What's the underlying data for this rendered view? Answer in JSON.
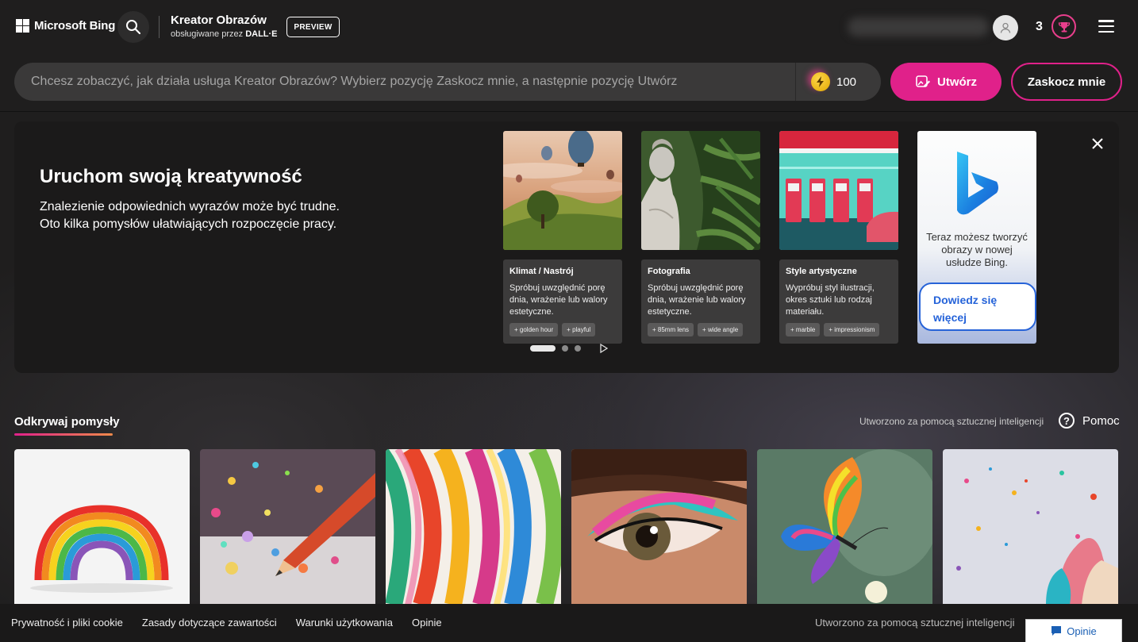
{
  "header": {
    "brand": "Microsoft Bing",
    "app_title": "Kreator Obrazów",
    "app_subtitle_prefix": "obsługiwane przez",
    "app_subtitle_engine": "DALL·E",
    "preview_badge": "PREVIEW",
    "coin_count": "3"
  },
  "prompt": {
    "placeholder": "Chcesz zobaczyć, jak działa usługa Kreator Obrazów? Wybierz pozycję Zaskocz mnie, a następnie pozycję Utwórz",
    "boost_count": "100",
    "create_label": "Utwórz",
    "surprise_label": "Zaskocz mnie"
  },
  "panel": {
    "title": "Uruchom swoją kreatywność",
    "line1": "Znalezienie odpowiednich wyrazów może być trudne.",
    "line2": "Oto kilka pomysłów ułatwiających rozpoczęcie pracy.",
    "cards": [
      {
        "title": "Klimat / Nastrój",
        "desc": "Spróbuj uwzględnić porę dnia, wrażenie lub walory estetyczne.",
        "chips": [
          "golden hour",
          "playful"
        ]
      },
      {
        "title": "Fotografia",
        "desc": "Spróbuj uwzględnić porę dnia, wrażenie lub walory estetyczne.",
        "chips": [
          "85mm lens",
          "wide angle"
        ]
      },
      {
        "title": "Style artystyczne",
        "desc": "Wypróbuj styl ilustracji, okres sztuki lub rodzaj materiału.",
        "chips": [
          "marble",
          "impressionism"
        ]
      }
    ],
    "ad": {
      "text": "Teraz możesz tworzyć obrazy w nowej usłudze Bing.",
      "button": "Dowiedz się więcej"
    }
  },
  "discover": {
    "tab": "Odkrywaj pomysły",
    "ai_note": "Utworzono za pomocą sztucznej inteligencji",
    "help": "Pomoc"
  },
  "footer": {
    "links": [
      "Prywatność i pliki cookie",
      "Zasady dotyczące zawartości",
      "Warunki użytkowania",
      "Opinie"
    ],
    "ai_note": "Utworzono za pomocą sztucznej inteligencji",
    "feedback": "Opinie"
  },
  "colors": {
    "accent": "#e0218a",
    "background": "#1f1e1e",
    "link_blue": "#2563d9"
  },
  "icons": [
    "windows-logo-icon",
    "search-icon",
    "user-avatar-icon",
    "trophy-icon",
    "hamburger-menu-icon",
    "coin-icon",
    "create-image-icon",
    "close-icon",
    "bing-logo-icon",
    "play-icon",
    "help-icon",
    "feedback-icon"
  ]
}
